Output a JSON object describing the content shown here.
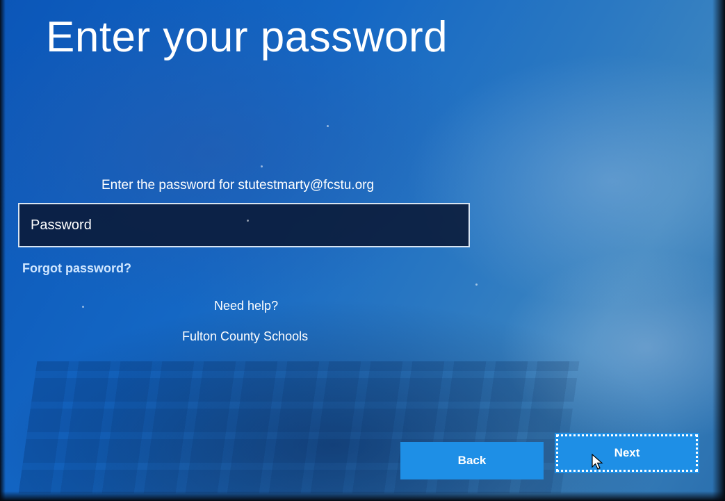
{
  "dialog": {
    "title": "Enter your password",
    "prompt": "Enter the password for stutestmarty@fcstu.org",
    "password_placeholder": "Password",
    "password_value": "",
    "forgot_link": "Forgot password?",
    "need_help": "Need help?",
    "organization": "Fulton County Schools"
  },
  "buttons": {
    "back_label": "Back",
    "next_label": "Next"
  },
  "icons": {
    "cursor": "mouse-pointer-icon"
  },
  "colors": {
    "background": "#1467c4",
    "button": "#1e8fe6",
    "input_background": "#0a1937",
    "link": "#cfe6ff",
    "text": "#ffffff"
  }
}
